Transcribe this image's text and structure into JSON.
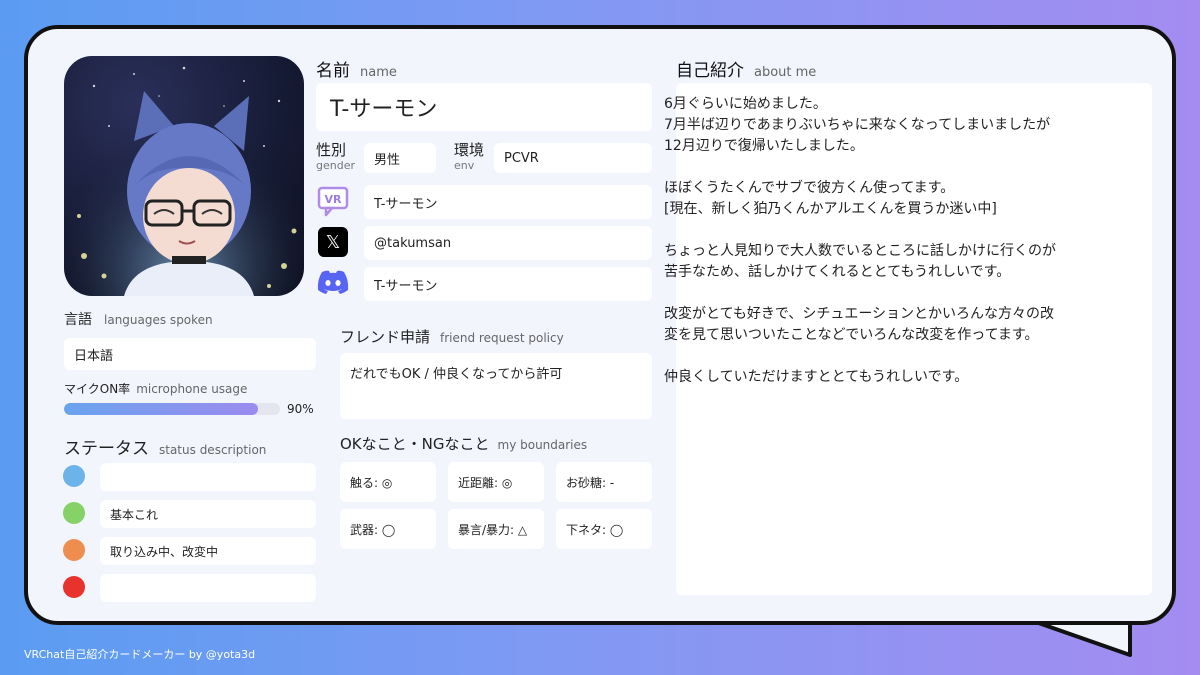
{
  "profile": {
    "name_label_jp": "名前",
    "name_label_en": "name",
    "name": "T-サーモン",
    "gender_label_jp": "性別",
    "gender_label_en": "gender",
    "gender": "男性",
    "env_label_jp": "環境",
    "env_label_en": "env",
    "env": "PCVR",
    "vrchat_name": "T-サーモン",
    "x_handle": "@takumsan",
    "discord_name": "T-サーモン",
    "vr_icon_text": "VR"
  },
  "languages": {
    "label_jp": "言語",
    "label_en": "languages spoken",
    "value": "日本語"
  },
  "mic": {
    "label_jp": "マイクON率",
    "label_en": "microphone usage",
    "percent_text": "90%",
    "fraction": 0.9
  },
  "status": {
    "label_jp": "ステータス",
    "label_en": "status description",
    "items": [
      {
        "color": "#6cb3ea",
        "text": ""
      },
      {
        "color": "#86d266",
        "text": "基本これ"
      },
      {
        "color": "#ef8d4e",
        "text": "取り込み中、改変中"
      },
      {
        "color": "#e8332c",
        "text": ""
      }
    ]
  },
  "friend": {
    "label_jp": "フレンド申請",
    "label_en": "friend request policy",
    "value": "だれでもOK / 仲良くなってから許可"
  },
  "boundaries": {
    "label_jp": "OKなこと・NGなこと",
    "label_en": "my boundaries",
    "items": [
      "触る: ◎",
      "近距離: ◎",
      "お砂糖: -",
      "武器: ◯",
      "暴言/暴力: △",
      "下ネタ: ◯"
    ]
  },
  "about": {
    "label_jp": "自己紹介",
    "label_en": "about me",
    "paragraphs": [
      [
        "6月ぐらいに始めました。",
        "7月半ば辺りであまりぶいちゃに来なくなってしまいましたが",
        "12月辺りで復帰いたしました。"
      ],
      [
        "ほぼくうたくんでサブで彼方くん使ってます。",
        "[現在、新しく狛乃くんかアルエくんを買うか迷い中]"
      ],
      [
        "ちょっと人見知りで大人数でいるところに話しかけに行くのが",
        "苦手なため、話しかけてくれるととてもうれしいです。"
      ],
      [
        "改変がとても好きで、シチュエーションとかいろんな方々の改",
        "変を見て思いついたことなどでいろんな改変を作ってます。"
      ],
      [
        "仲良くしていただけますととてもうれしいです。"
      ]
    ]
  },
  "footer": "VRChat自己紹介カードメーカー by @yota3d",
  "colors": {
    "card_bg": "#f3f5fd",
    "border": "#111111",
    "bar_fill": "#8a8ff0",
    "discord": "#5865f2",
    "x_bg": "#000000"
  }
}
